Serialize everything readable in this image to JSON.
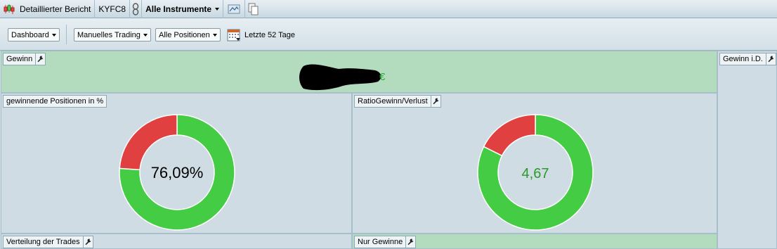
{
  "titlebar": {
    "report_label": "Detaillierter Bericht",
    "account": "KYFC8",
    "instruments": "Alle Instrumente"
  },
  "toolbar": {
    "dashboard": "Dashboard",
    "trading": "Manuelles Trading",
    "positions": "Alle Positionen",
    "period": "Letzte 52 Tage"
  },
  "panels": {
    "gewinn": {
      "label": "Gewinn",
      "currency": "€"
    },
    "gewinn_id": {
      "label": "Gewinn i.D."
    },
    "winning_positions": {
      "label": "gewinnende Positionen in %",
      "value_text": "76,09%"
    },
    "ratio": {
      "label": "RatioGewinn/Verlust",
      "value_text": "4,67"
    },
    "distribution": {
      "label": "Verteilung der Trades"
    },
    "only_wins": {
      "label": "Nur Gewinne"
    }
  },
  "chart_data": [
    {
      "type": "pie",
      "title": "gewinnende Positionen in %",
      "center_label": "76,09%",
      "slices": [
        {
          "value": 76.09,
          "color": "#44cc44"
        },
        {
          "value": 23.91,
          "color": "#e04040"
        }
      ]
    },
    {
      "type": "pie",
      "title": "RatioGewinn/Verlust",
      "center_label": "4,67",
      "slices": [
        {
          "value": 4.67,
          "color": "#44cc44"
        },
        {
          "value": 1,
          "color": "#e04040"
        }
      ]
    }
  ],
  "colors": {
    "win": "#44cc44",
    "loss": "#e04040",
    "ratio_text": "#2a9a2a"
  }
}
